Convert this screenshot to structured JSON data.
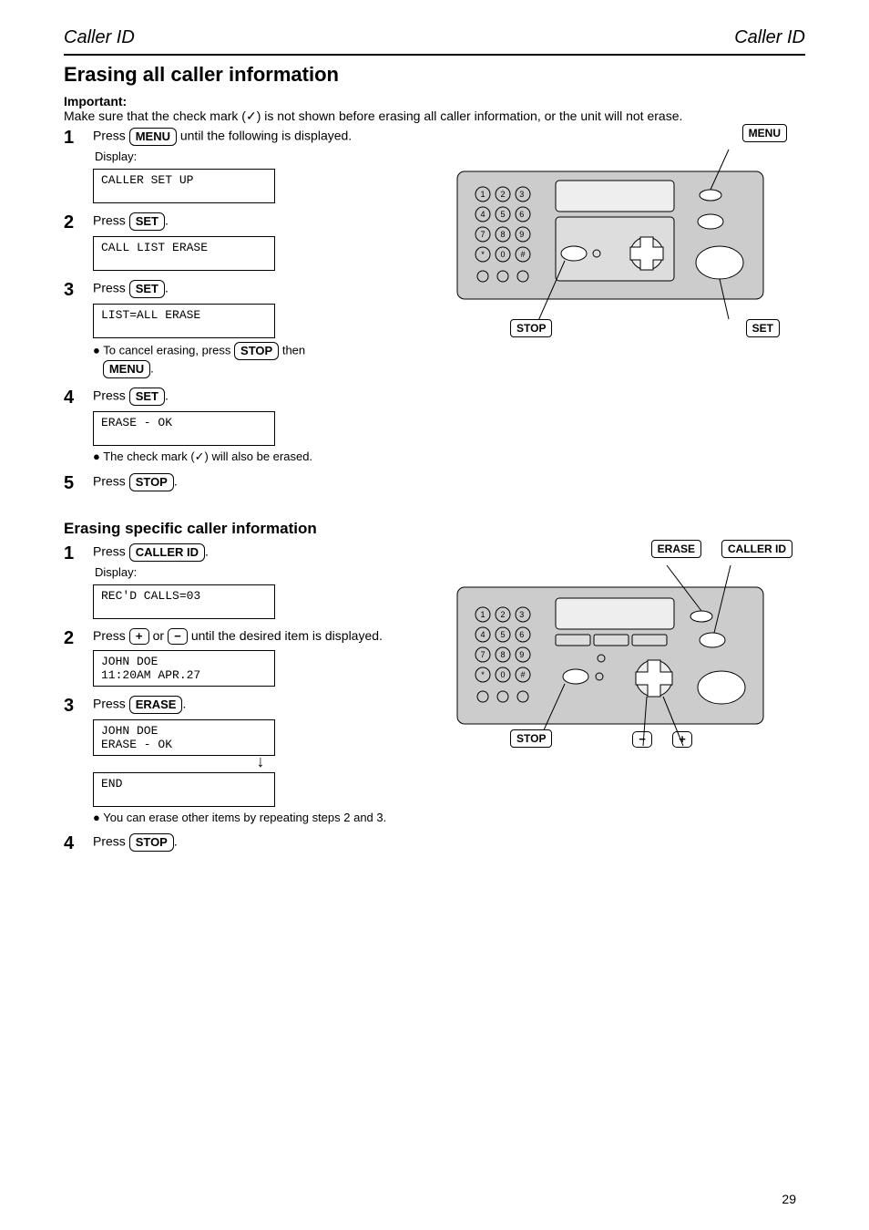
{
  "header": {
    "left": "Caller ID",
    "right": "Caller ID"
  },
  "section1": {
    "title": "Erasing all caller information",
    "preamble": "Important:",
    "preamble_text": "Make sure that the check mark (✓) is not shown before erasing all caller information, or the unit will not erase.",
    "steps": {
      "s1": {
        "prefix": "Press ",
        "key": "MENU",
        "mid": " until the following is displayed.",
        "display_caption": "Display:",
        "display": "CALLER SET UP"
      },
      "s2": {
        "prefix": "Press ",
        "key": "SET",
        "after": ".",
        "display": "CALL LIST ERASE"
      },
      "s3": {
        "prefix": "Press ",
        "key": "SET",
        "after": ".",
        "display": "LIST=ALL ERASE",
        "bullet_a": "To cancel erasing, press ",
        "bullet_a_key": "STOP",
        "bullet_a_after": " then",
        "bullet_b_key": "MENU",
        "bullet_b_after": "."
      },
      "s4": {
        "prefix": "Press ",
        "key": "SET",
        "after": ".",
        "display": "ERASE - OK",
        "bullet": "The check mark (✓) will also be erased."
      },
      "s5": {
        "prefix": "Press ",
        "key": "STOP",
        "after": "."
      }
    },
    "panel_labels": {
      "top_right": "MENU",
      "bottom_left": "STOP",
      "bottom_right": "SET"
    }
  },
  "section2": {
    "title": "Erasing specific caller information",
    "steps": {
      "s1": {
        "prefix": "Press ",
        "key": "CALLER ID",
        "after": ".",
        "display_caption": "Display:",
        "display": "REC'D CALLS=03"
      },
      "s2": {
        "prefix": "Press ",
        "key1": "+",
        "mid": " or ",
        "key2": "−",
        "after": " until the desired item is displayed.",
        "display_l1": "JOHN DOE",
        "display_l2": "11:20AM  APR.27"
      },
      "s3": {
        "prefix": "Press ",
        "key": "ERASE",
        "after": ".",
        "display1": "JOHN DOE",
        "display1_l2": "ERASE - OK",
        "display2": "END",
        "bullet": "You can erase other items by repeating steps 2 and 3."
      },
      "s4": {
        "prefix": "Press ",
        "key": "STOP",
        "after": "."
      }
    },
    "panel_labels": {
      "tr1": "ERASE",
      "tr2": "CALLER ID",
      "bottom_left": "STOP"
    }
  },
  "footer": "29"
}
